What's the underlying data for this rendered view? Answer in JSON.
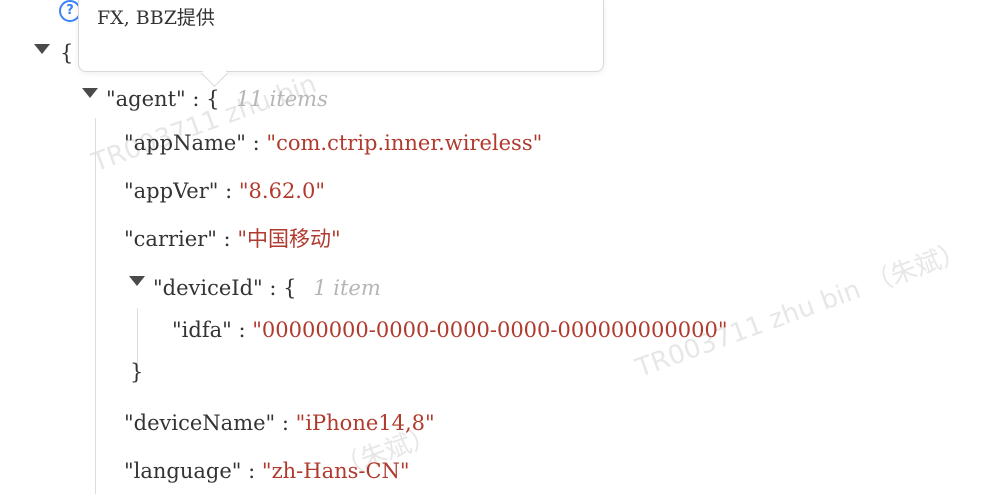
{
  "tooltip": {
    "help_icon": "?",
    "text": "FX, BBZ提供"
  },
  "json_view": {
    "root_open": "{",
    "agent": {
      "key": "\"agent\"",
      "colon": ":",
      "brace_open": "{",
      "count": "11 items"
    },
    "fields": {
      "appName": {
        "key": "\"appName\"",
        "colon": ":",
        "value": "\"com.ctrip.inner.wireless\""
      },
      "appVer": {
        "key": "\"appVer\"",
        "colon": ":",
        "value": "\"8.62.0\""
      },
      "carrier": {
        "key": "\"carrier\"",
        "colon": ":",
        "value": "\"中国移动\""
      },
      "deviceId": {
        "key": "\"deviceId\"",
        "colon": ":",
        "brace_open": "{",
        "count": "1 item",
        "brace_close": "}"
      },
      "idfa": {
        "key": "\"idfa\"",
        "colon": ":",
        "value": "\"00000000-0000-0000-0000-000000000000\""
      },
      "deviceName": {
        "key": "\"deviceName\"",
        "colon": ":",
        "value": "\"iPhone14,8\""
      },
      "language": {
        "key": "\"language\"",
        "colon": ":",
        "value": "\"zh-Hans-CN\""
      }
    }
  },
  "watermarks": {
    "mark1": "TR003711 zhu bin",
    "mark2": "TR003711 zhu bin （朱斌）",
    "mark3": "（朱斌）"
  },
  "colors": {
    "string_value": "#b03a2e",
    "key_text": "#333333",
    "item_count": "#b5b5b5",
    "help_icon": "#3b82f6"
  }
}
